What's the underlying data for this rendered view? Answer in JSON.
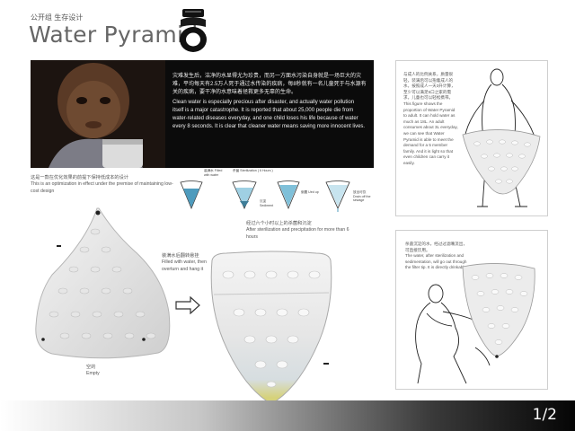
{
  "header": {
    "category": "公开组 生存设计",
    "title": "Water Pyramid"
  },
  "banner": {
    "text_cn": "灾难发生后，洁净的水显得尤为珍贵，而另一方面水污染自身就是一场巨大的灾难，平均每天有2.5万人死于通过水传染的疾病，每8秒就有一名儿童死于与水源有关的疾病，要干净的水意味着拯救更多无辜的生命。",
    "text_en": "Clean water is especially precious after disaster, and actually water pollution itself is a major catastrophe. It is reported that about 25,000 people die from water-related diseases everyday, and one child loses his life because of water every 8 seconds. It is clear that cleaner water means saving more innocent lives."
  },
  "stages": [
    {
      "label": "装满水 Filled with water"
    },
    {
      "label": "杀菌 Sterilization ( 6 Hours )",
      "sub": "沉淀 Sediment"
    },
    {
      "label": "倒置 Ued up"
    },
    {
      "label": "放出可饮 Drain off the sewage"
    }
  ],
  "left": {
    "caption_cn": "这是一款在优化效果的前提下保持低成本的设计",
    "caption_en": "This is an optimization in effect under the premise of maintaining low-cost design",
    "empty_cn": "空的",
    "empty_en": "Empty"
  },
  "middle": {
    "fill_cn": "装满水后翻转悬挂",
    "fill_en": "Filled with water, then overturn and hang it",
    "steril_cn": "经过六个小时以上的杀菌和沉淀",
    "steril_en": "After sterilization and precipitation for more than 6 hours"
  },
  "right_top": {
    "text_cn": "与成人的比例关系，质量很轻，装满后可以抱着成人的水，按照成人一天3升计算，至少可以满足5口之家的需求，儿童也可以轻松携带。",
    "text_en": "This figure shows the proportion of Water Pyramid to adult. It can hold water as much as 18L. An adult consumes about 3L everyday, we can see that Water Pyramid is able to meet the demand for a 5 member family. And it is light so that even children can carry it easily."
  },
  "right_bottom": {
    "text_cn": "杀菌沉淀的水，经过过滤嘴流出，可直接饮用。",
    "text_en": "The water, after sterilization and sedimentation, will go out through the filter tip. It is directly drinkable."
  },
  "footer": {
    "page": "1/2"
  },
  "colors": {
    "accent_blue": "#4e9bbd",
    "footer_dark": "#050505"
  }
}
